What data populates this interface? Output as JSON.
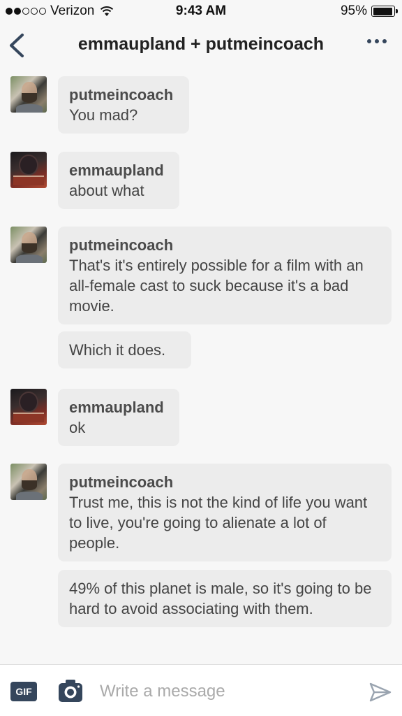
{
  "status_bar": {
    "carrier": "Verizon",
    "time": "9:43 AM",
    "battery": "95%",
    "battery_level": 0.95,
    "signal_bars": 2
  },
  "header": {
    "title": "emmaupland + putmeincoach"
  },
  "messages": [
    {
      "author": "putmeincoach",
      "lines": [
        "You mad?"
      ]
    },
    {
      "author": "emmaupland",
      "lines": [
        "about what"
      ]
    },
    {
      "author": "putmeincoach",
      "lines": [
        "That's it's entirely possible for a film with an all-female cast to suck because it's a bad movie.",
        "Which it does."
      ]
    },
    {
      "author": "emmaupland",
      "lines": [
        "ok"
      ]
    },
    {
      "author": "putmeincoach",
      "lines": [
        "Trust me, this is not the kind of life you want to live, you're going to alienate a lot of people.",
        "49% of this planet is male, so it's going to be hard to avoid associating with them."
      ]
    }
  ],
  "composer": {
    "gif_label": "GIF",
    "placeholder": "Write a message"
  },
  "colors": {
    "accent": "#35465c",
    "bubble": "#ececec",
    "background": "#f7f7f7"
  },
  "icons": {
    "back": "chevron-left-icon",
    "more": "more-horizontal-icon",
    "camera": "camera-icon",
    "send": "send-icon",
    "wifi": "wifi-icon"
  }
}
